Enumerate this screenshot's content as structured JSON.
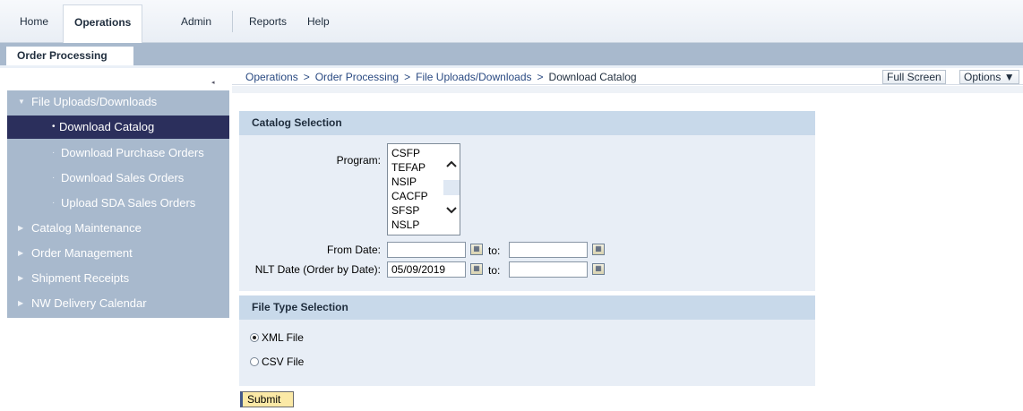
{
  "top_nav": {
    "tabs": [
      {
        "label": "Home",
        "active": false
      },
      {
        "label": "Operations",
        "active": true
      },
      {
        "label": "Admin",
        "active": false
      },
      {
        "label": "Reports",
        "active": false
      },
      {
        "label": "Help",
        "active": false
      }
    ]
  },
  "sub_nav": {
    "active_tab": "Order Processing"
  },
  "breadcrumb": {
    "items": [
      "Operations",
      "Order Processing",
      "File Uploads/Downloads"
    ],
    "separator": ">",
    "current": "Download Catalog"
  },
  "header_buttons": {
    "full_screen": "Full Screen",
    "options": "Options ▼"
  },
  "sidebar": {
    "collapse_icon": "◂",
    "section": {
      "label": "File Uploads/Downloads",
      "expanded": true
    },
    "children": [
      {
        "label": "Download Catalog",
        "selected": true
      },
      {
        "label": "Download Purchase Orders",
        "selected": false
      },
      {
        "label": "Download Sales Orders",
        "selected": false
      },
      {
        "label": "Upload SDA Sales Orders",
        "selected": false
      }
    ],
    "other_sections": [
      {
        "label": "Catalog Maintenance"
      },
      {
        "label": "Order Management"
      },
      {
        "label": "Shipment Receipts"
      },
      {
        "label": "NW Delivery Calendar"
      }
    ]
  },
  "catalog_selection": {
    "title": "Catalog Selection",
    "program_label": "Program:",
    "program_options": [
      "CSFP",
      "TEFAP",
      "NSIP",
      "CACFP",
      "SFSP",
      "NSLP"
    ],
    "from_date_label": "From Date:",
    "from_date_value": "",
    "from_date_to_label": "to:",
    "from_date_to_value": "",
    "nlt_date_label": "NLT Date (Order by Date):",
    "nlt_date_value": "05/09/2019",
    "nlt_date_to_label": "to:",
    "nlt_date_to_value": ""
  },
  "file_type_selection": {
    "title": "File Type Selection",
    "options": [
      {
        "label": "XML File",
        "checked": true
      },
      {
        "label": "CSV File",
        "checked": false
      }
    ]
  },
  "submit_label": "Submit",
  "colors": {
    "nav_panel": "#a8b9cd",
    "selected_item": "#2b2f5c",
    "panel_header": "#c8d9ea",
    "panel_body": "#e8eef6",
    "submit_bg": "#fbe9a6"
  }
}
